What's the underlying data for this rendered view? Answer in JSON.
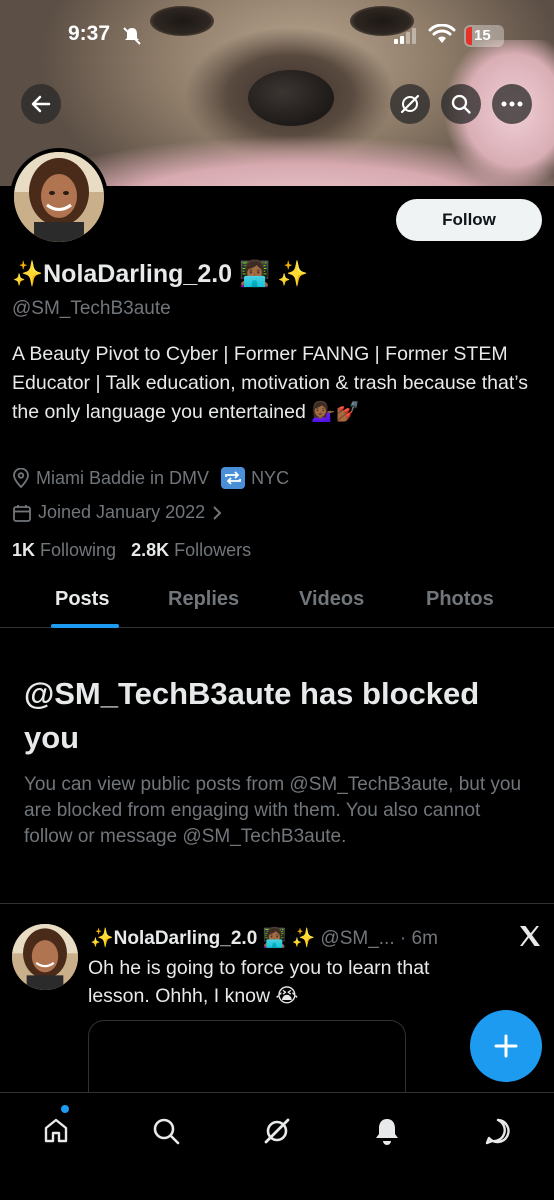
{
  "status_bar": {
    "time": "9:37",
    "battery": "15"
  },
  "profile": {
    "display_name": "✨NolaDarling_2.0 👩🏾‍💻 ✨",
    "handle": "@SM_TechB3aute",
    "bio": "A Beauty Pivot to Cyber | Former FANNG | Former STEM Educator | Talk education, motivation & trash because that’s the only language you entertained 💁🏾‍♀️💅🏾",
    "location_a": "Miami Baddie in DMV",
    "location_b": "NYC",
    "joined": "Joined January 2022",
    "following_count": "1K",
    "following_label": "Following",
    "followers_count": "2.8K",
    "followers_label": "Followers",
    "follow_button": "Follow"
  },
  "tabs": [
    {
      "label": "Posts"
    },
    {
      "label": "Replies"
    },
    {
      "label": "Videos"
    },
    {
      "label": "Photos"
    }
  ],
  "blocked": {
    "title": "@SM_TechB3aute has blocked you",
    "text": "You can view public posts from @SM_TechB3aute, but you are blocked from engaging with them. You also cannot follow or message @SM_TechB3aute."
  },
  "post": {
    "author": "✨NolaDarling_2.0 👩🏾‍💻 ✨",
    "handle": "@SM_...",
    "time": "· 6m",
    "text": "Oh he is going to force you  to learn that lesson. Ohhh, I know 😭"
  },
  "colors": {
    "accent": "#1d9bf0",
    "background": "#000000",
    "muted": "#71767b"
  }
}
